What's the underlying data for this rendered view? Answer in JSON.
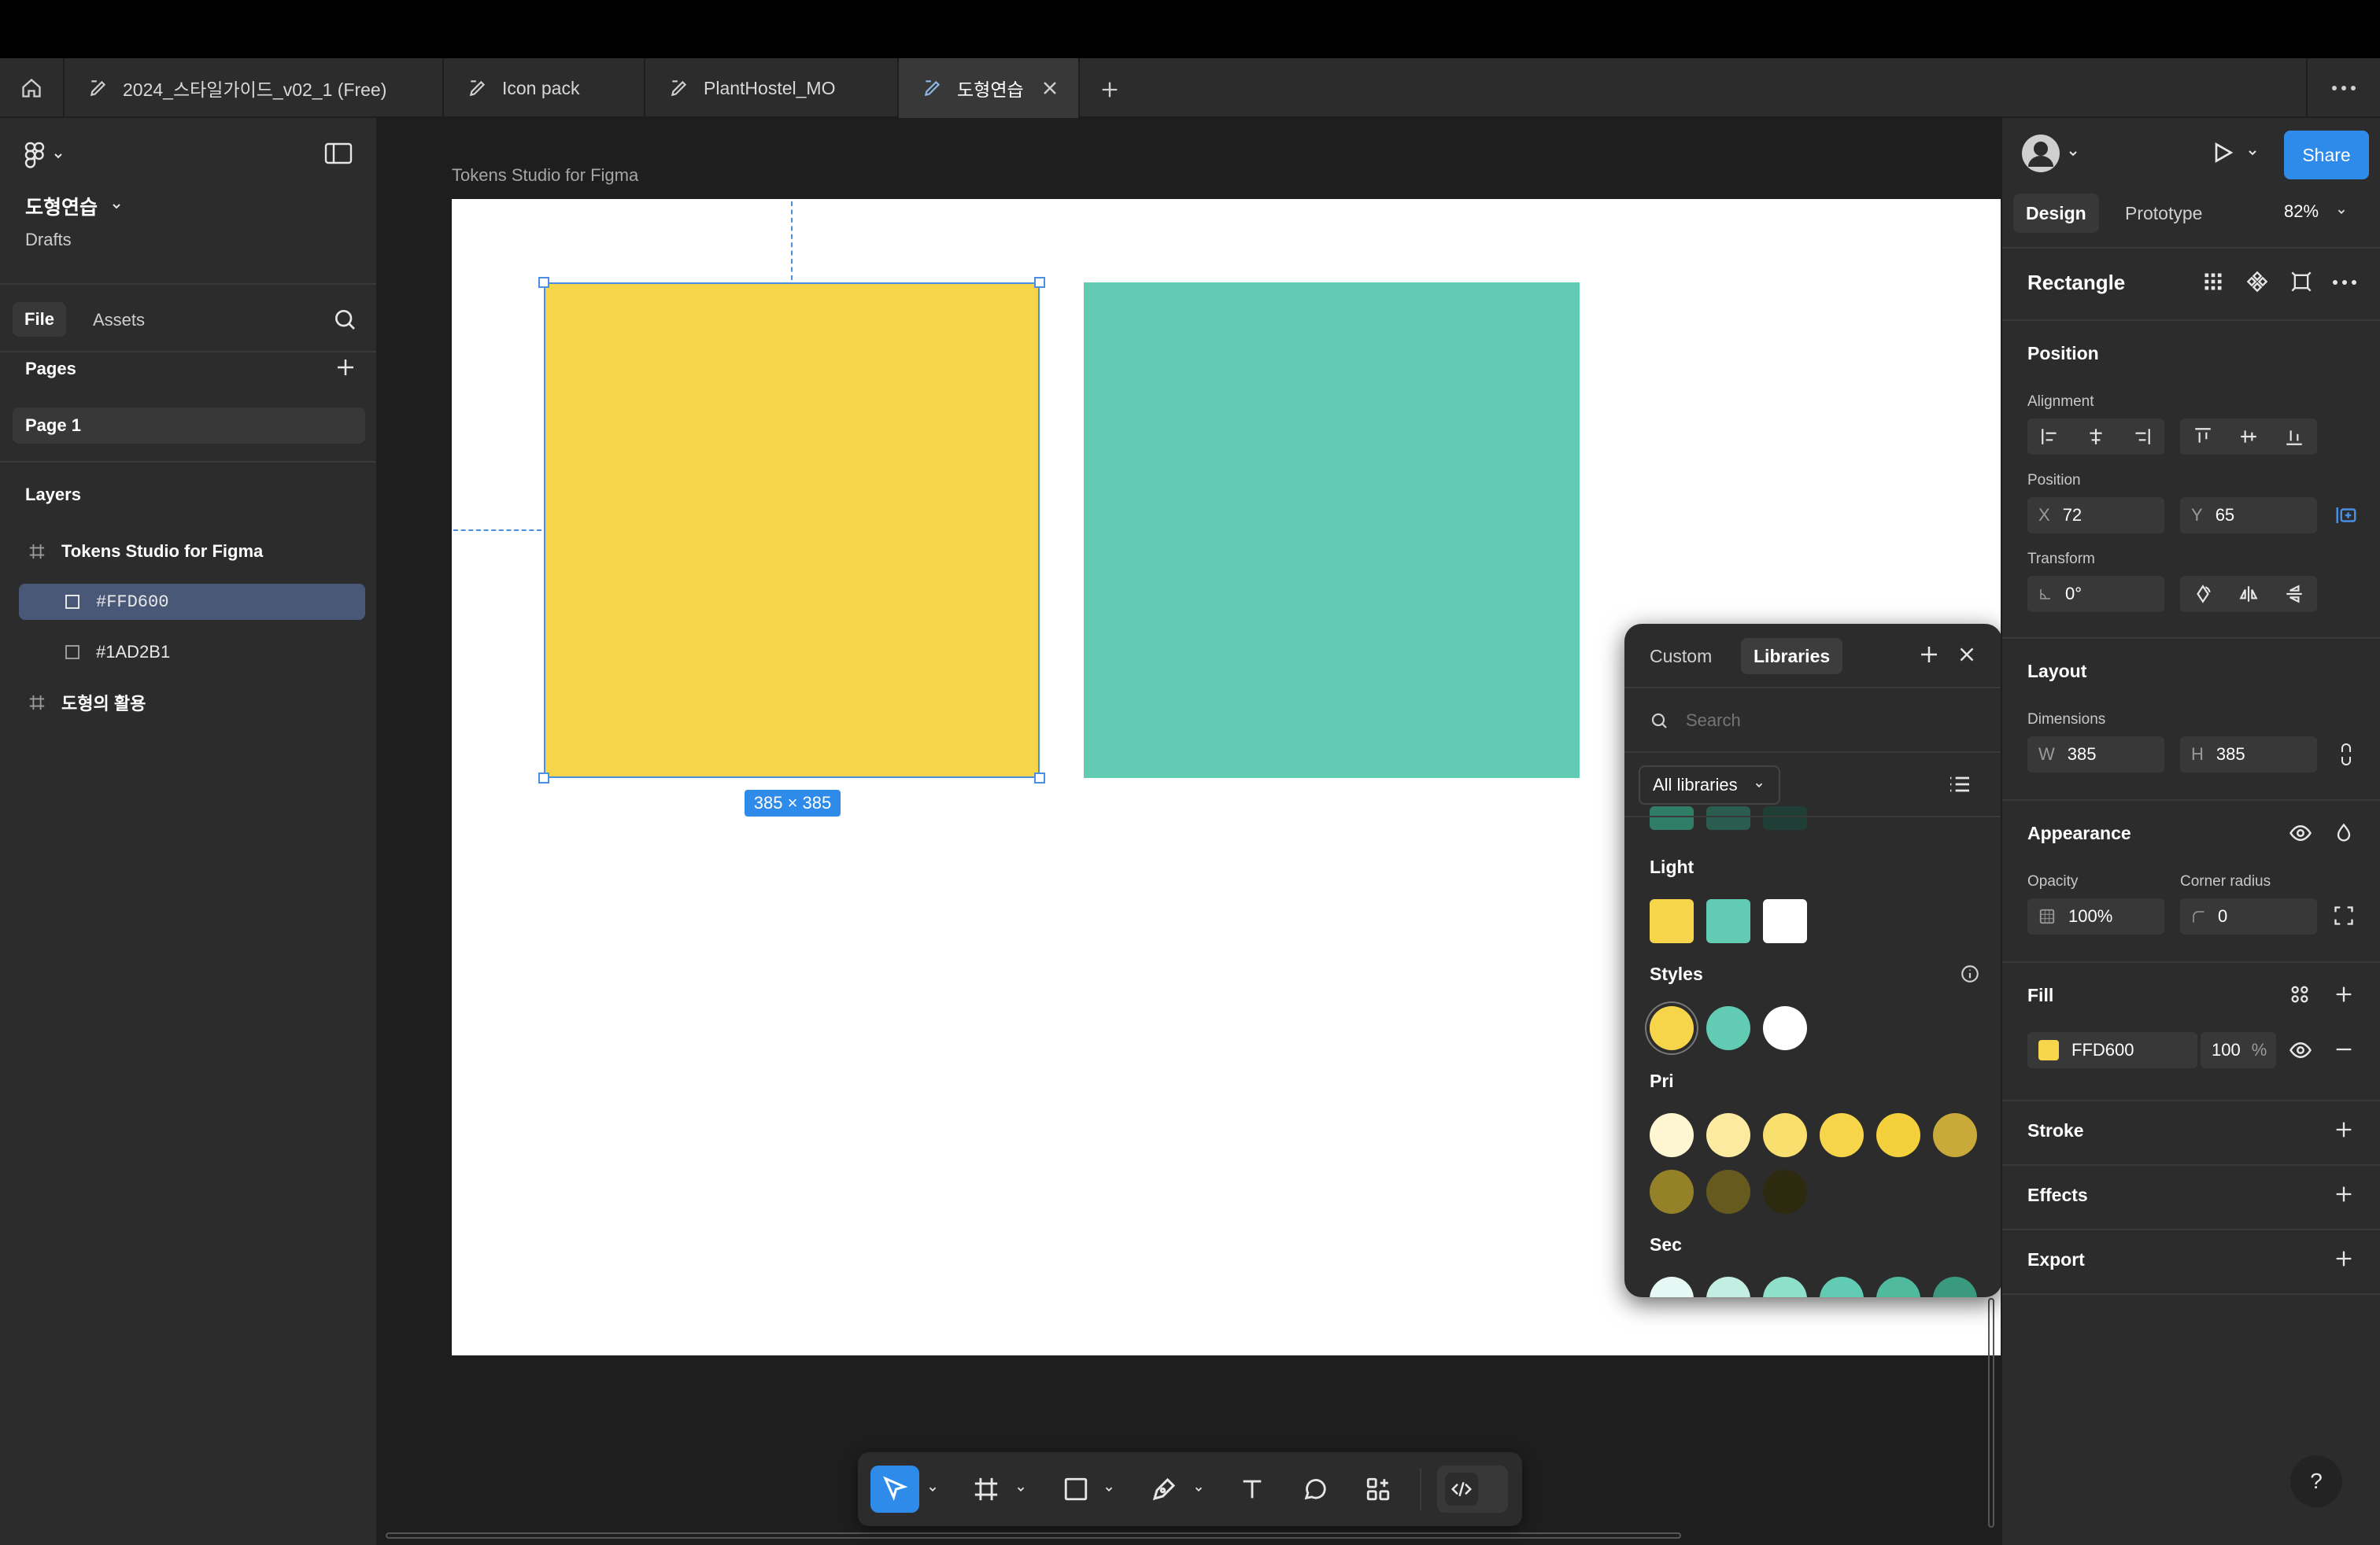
{
  "tabs": [
    {
      "label": "2024_스타일가이드_v02_1 (Free)"
    },
    {
      "label": "Icon pack"
    },
    {
      "label": "PlantHostel_MO"
    },
    {
      "label": "도형연습",
      "active": true
    }
  ],
  "file": {
    "name": "도형연습",
    "location": "Drafts"
  },
  "left_tabs": {
    "file": "File",
    "assets": "Assets"
  },
  "pages": {
    "heading": "Pages",
    "items": [
      "Page 1"
    ]
  },
  "layers": {
    "heading": "Layers",
    "items": [
      {
        "label": "Tokens Studio for Figma",
        "type": "frame"
      },
      {
        "label": "#FFD600",
        "type": "rect",
        "selected": true
      },
      {
        "label": "#1AD2B1",
        "type": "rect"
      },
      {
        "label": "도형의 활용",
        "type": "frame"
      }
    ]
  },
  "canvas": {
    "frame_label": "Tokens Studio for Figma",
    "size_badge": "385 × 385",
    "colors": {
      "yellow": "#f6d54a",
      "green": "#61ccb3",
      "selection": "#4a8fe0"
    }
  },
  "popup": {
    "tabs": {
      "custom": "Custom",
      "libraries": "Libraries"
    },
    "search_placeholder": "Search",
    "filter": "All libraries",
    "sections": {
      "light": "Light",
      "styles": "Styles",
      "pri": "Pri",
      "sec": "Sec"
    },
    "top_partial_colors": [
      "#2f7d67",
      "#2a5c50",
      "#1f3f36"
    ],
    "light_colors": [
      "#f6d54a",
      "#61ccb3",
      "#ffffff"
    ],
    "style_colors": [
      "#f6d54a",
      "#61ccb3",
      "#ffffff"
    ],
    "pri_colors": [
      "#fdf6d0",
      "#fbeaa0",
      "#f8df6e",
      "#f6d54a",
      "#f4d03c",
      "#c8a93a",
      "#958128",
      "#665a1e",
      "#2d2a10"
    ],
    "sec_colors": [
      "#e6f8f3",
      "#c3efe3",
      "#8fe0cb",
      "#61ccb3",
      "#4fba9e",
      "#3a9a80"
    ]
  },
  "right": {
    "tabs": {
      "design": "Design",
      "prototype": "Prototype"
    },
    "zoom": "82%",
    "share": "Share",
    "element_title": "Rectangle",
    "position_heading": "Position",
    "alignment_label": "Alignment",
    "position_label": "Position",
    "x": {
      "prefix": "X",
      "value": "72"
    },
    "y": {
      "prefix": "Y",
      "value": "65"
    },
    "transform_label": "Transform",
    "rotation": "0°",
    "layout_heading": "Layout",
    "dimensions_label": "Dimensions",
    "w": {
      "prefix": "W",
      "value": "385"
    },
    "h": {
      "prefix": "H",
      "value": "385"
    },
    "appearance_heading": "Appearance",
    "opacity_label": "Opacity",
    "opacity": "100%",
    "corner_label": "Corner radius",
    "corner": "0",
    "fill_heading": "Fill",
    "fill_hex": "FFD600",
    "fill_color": "#f6d54a",
    "fill_opacity": "100",
    "fill_pct": "%",
    "stroke": "Stroke",
    "effects": "Effects",
    "export": "Export"
  },
  "accent": "#2f8bea",
  "help": "?"
}
